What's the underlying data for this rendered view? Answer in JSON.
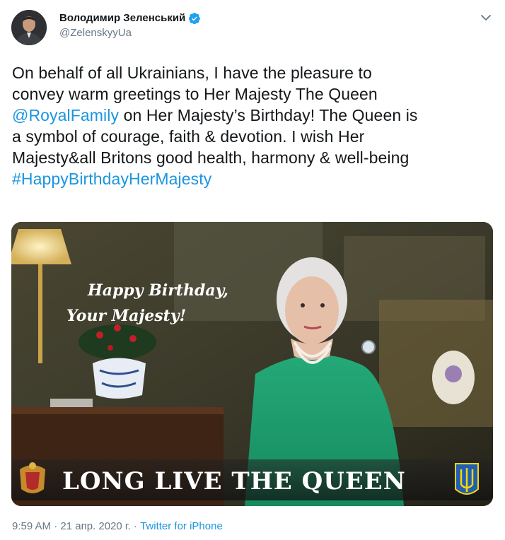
{
  "tweet": {
    "author": {
      "display_name": "Володимир Зеленський",
      "handle": "@ZelenskyyUa",
      "verified": true
    },
    "text_lines": [
      {
        "plain": "On behalf of all Ukrainians, I have the pleasure to"
      },
      {
        "plain": "convey warm greetings to Her Majesty The Queen"
      },
      {
        "link": "@RoyalFamily",
        "rest": " on Her Majesty’s Birthday! The Queen is"
      },
      {
        "plain": "a symbol of courage, faith & devotion. I wish Her"
      },
      {
        "plain": "Majesty&all Britons good health, harmony & well-being"
      },
      {
        "link": "#HappyBirthdayHerMajesty"
      }
    ],
    "media": {
      "overlay_line1": "Happy Birthday,",
      "overlay_line2": "Your Majesty!",
      "banner_text": "LONG LIVE THE QUEEN"
    },
    "meta": {
      "time": "9:59 AM",
      "separator": " · ",
      "date": "21 апр. 2020 г.",
      "separator2": " · ",
      "source": "Twitter for iPhone"
    }
  },
  "colors": {
    "link": "#1b95e0",
    "secondary_text": "#657786",
    "verified": "#1da1f2",
    "queen_dress": "#1f9e6e"
  },
  "icons": {
    "verified": "verified-badge-icon",
    "caret": "chevron-down-icon",
    "royal_arms": "royal-coat-of-arms-icon",
    "ukraine_trident": "ukraine-trident-icon"
  }
}
